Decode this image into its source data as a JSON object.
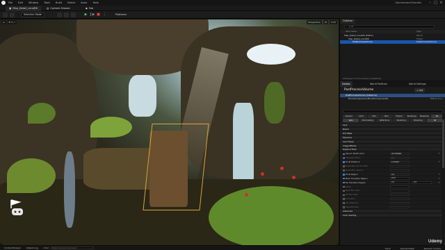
{
  "app": {
    "menu": [
      "File",
      "Edit",
      "Window",
      "Tools",
      "Build",
      "Select",
      "Actor",
      "Help"
    ],
    "project": "StonemasonTutorials"
  },
  "tabs": {
    "level": "Map_Detail_LandDK",
    "content_drawer": "Content Drawer",
    "fab": "Fab"
  },
  "toolbar": {
    "mode": "Selection Mode",
    "platforms": "Platforms"
  },
  "viewport": {
    "left_buttons": [
      "≡",
      "Perspective",
      "Lit",
      "Show"
    ],
    "right_buttons": [
      "Perspective",
      "Lit",
      "0.25"
    ]
  },
  "outliner": {
    "tab": "Outliner",
    "search_placeholder": "post",
    "col_item": "Item Label",
    "col_type": "Type",
    "rows": [
      {
        "name": "Map_Detail_LandDK (Editor)",
        "type": "World"
      },
      {
        "name": "Map_Detail_LandDK",
        "type": "Folder"
      },
      {
        "name": "PostProcessVolume",
        "type": "PostProcessVolume"
      }
    ],
    "status": "Showing 1 of 211 actors (1 selected)"
  },
  "details": {
    "tabs": [
      "Details",
      "World Partition",
      "World Settings"
    ],
    "actor": "PostProcessVolume",
    "add_label": "+ Add",
    "components": [
      {
        "name": "PostProcessVolume (Instance)",
        "edit": ""
      },
      {
        "name": "BrushComponent (BrushComponent0)",
        "edit": "Edit in C++"
      }
    ],
    "filters_row1": [
      "General",
      "Actor",
      "LOD",
      "Misc",
      "Physics",
      "Rendering",
      "Streaming",
      "All"
    ],
    "filters_row2": [
      "Lens",
      "Post Grading",
      "Reflections",
      "Rendering",
      "Streaming",
      "All"
    ],
    "properties": [
      {
        "name": "Lens",
        "kind": "cat"
      },
      {
        "name": "Bloom",
        "kind": "cat"
      },
      {
        "name": "Dirt Mask",
        "kind": "cat"
      },
      {
        "name": "Exposure",
        "kind": "cat"
      },
      {
        "name": "Lens Flares",
        "kind": "cat"
      },
      {
        "name": "Image Effects",
        "kind": "cat"
      },
      {
        "name": "Depth of Field",
        "kind": "cat"
      },
      {
        "name": "Sensor Width (mm)",
        "value": "24.576000",
        "check": true
      },
      {
        "name": "Squeeze Factor",
        "value": "2.0",
        "dim": true
      },
      {
        "name": "Focal Distance",
        "value": "1710.00",
        "check": true
      },
      {
        "name": "Depth Blur km for 50%",
        "value": "",
        "dim": true
      },
      {
        "name": "Depth Blur Radius",
        "value": "",
        "dim": true
      },
      {
        "name": "Focal Region",
        "value": "0.0",
        "check": true
      },
      {
        "name": "Near Transition Region",
        "value": "10.0",
        "check": true
      },
      {
        "name": "Far Transition Region",
        "value": "5.0",
        "value2": "5.0",
        "check": true
      },
      {
        "name": "Scale",
        "value": "",
        "dim": true
      },
      {
        "name": "Near Blur Size",
        "value": "",
        "dim": true
      },
      {
        "name": "Far Blur Size",
        "value": "",
        "dim": true
      },
      {
        "name": "Occlusion",
        "value": "",
        "dim": true
      },
      {
        "name": "Sky Distance",
        "value": "",
        "dim": true
      },
      {
        "name": "Vignette Size",
        "value": "",
        "dim": true
      },
      {
        "name": "Advanced",
        "kind": "cat"
      },
      {
        "name": "Color Grading",
        "kind": "cat"
      }
    ]
  },
  "statusbar": {
    "items": [
      "Content Drawer",
      "Output Log",
      "Cmd"
    ],
    "cmd_placeholder": "Enter Console Command",
    "right": [
      "Trace",
      "Derived Data",
      "Revision Control"
    ]
  },
  "watermark": "Udemy",
  "colors": {
    "accent": "#1c56a8",
    "selection_box": "#d9a637"
  }
}
